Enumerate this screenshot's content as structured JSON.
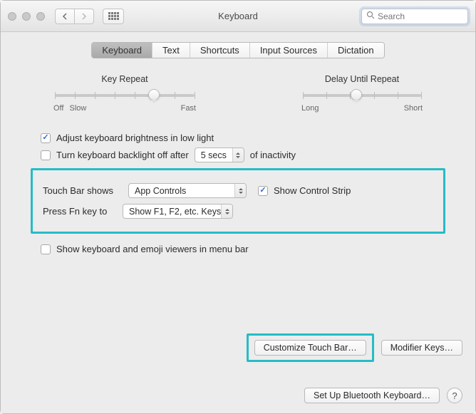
{
  "window": {
    "title": "Keyboard"
  },
  "search": {
    "placeholder": "Search",
    "value": ""
  },
  "tabs": [
    "Keyboard",
    "Text",
    "Shortcuts",
    "Input Sources",
    "Dictation"
  ],
  "tabs_active_index": 0,
  "sliders": {
    "key_repeat": {
      "label": "Key Repeat",
      "left1": "Off",
      "left2": "Slow",
      "right": "Fast"
    },
    "delay": {
      "label": "Delay Until Repeat",
      "left": "Long",
      "right": "Short"
    }
  },
  "options": {
    "adjust_brightness": "Adjust keyboard brightness in low light",
    "backlight_off_prefix": "Turn keyboard backlight off after",
    "backlight_off_value": "5 secs",
    "backlight_off_suffix": "of inactivity",
    "touchbar_label": "Touch Bar shows",
    "touchbar_value": "App Controls",
    "show_control_strip": "Show Control Strip",
    "fn_label": "Press Fn key to",
    "fn_value": "Show F1, F2, etc. Keys",
    "show_viewers": "Show keyboard and emoji viewers in menu bar"
  },
  "buttons": {
    "customize": "Customize Touch Bar…",
    "modifier": "Modifier Keys…",
    "bluetooth": "Set Up Bluetooth Keyboard…",
    "help": "?"
  }
}
